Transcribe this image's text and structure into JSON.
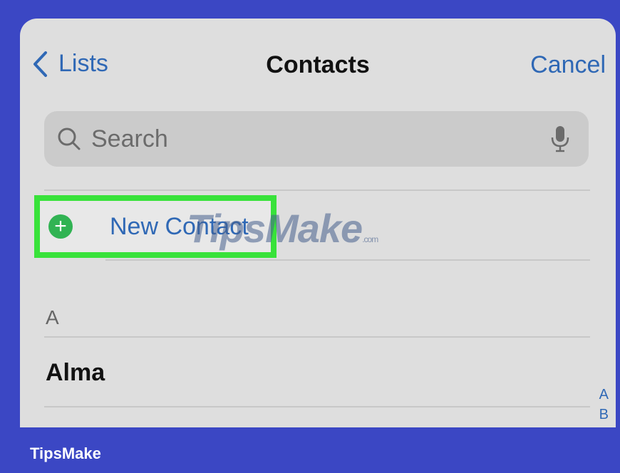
{
  "nav": {
    "back_label": "Lists",
    "title": "Contacts",
    "cancel_label": "Cancel"
  },
  "search": {
    "placeholder": "Search"
  },
  "new_contact": {
    "label": "New Contact"
  },
  "list": {
    "section_header": "A",
    "contacts": [
      "Alma"
    ],
    "index_letters": [
      "A",
      "B"
    ]
  },
  "watermark": {
    "text": "TipsMake",
    "suffix": ".com"
  },
  "footer": {
    "brand": "TipsMake"
  }
}
